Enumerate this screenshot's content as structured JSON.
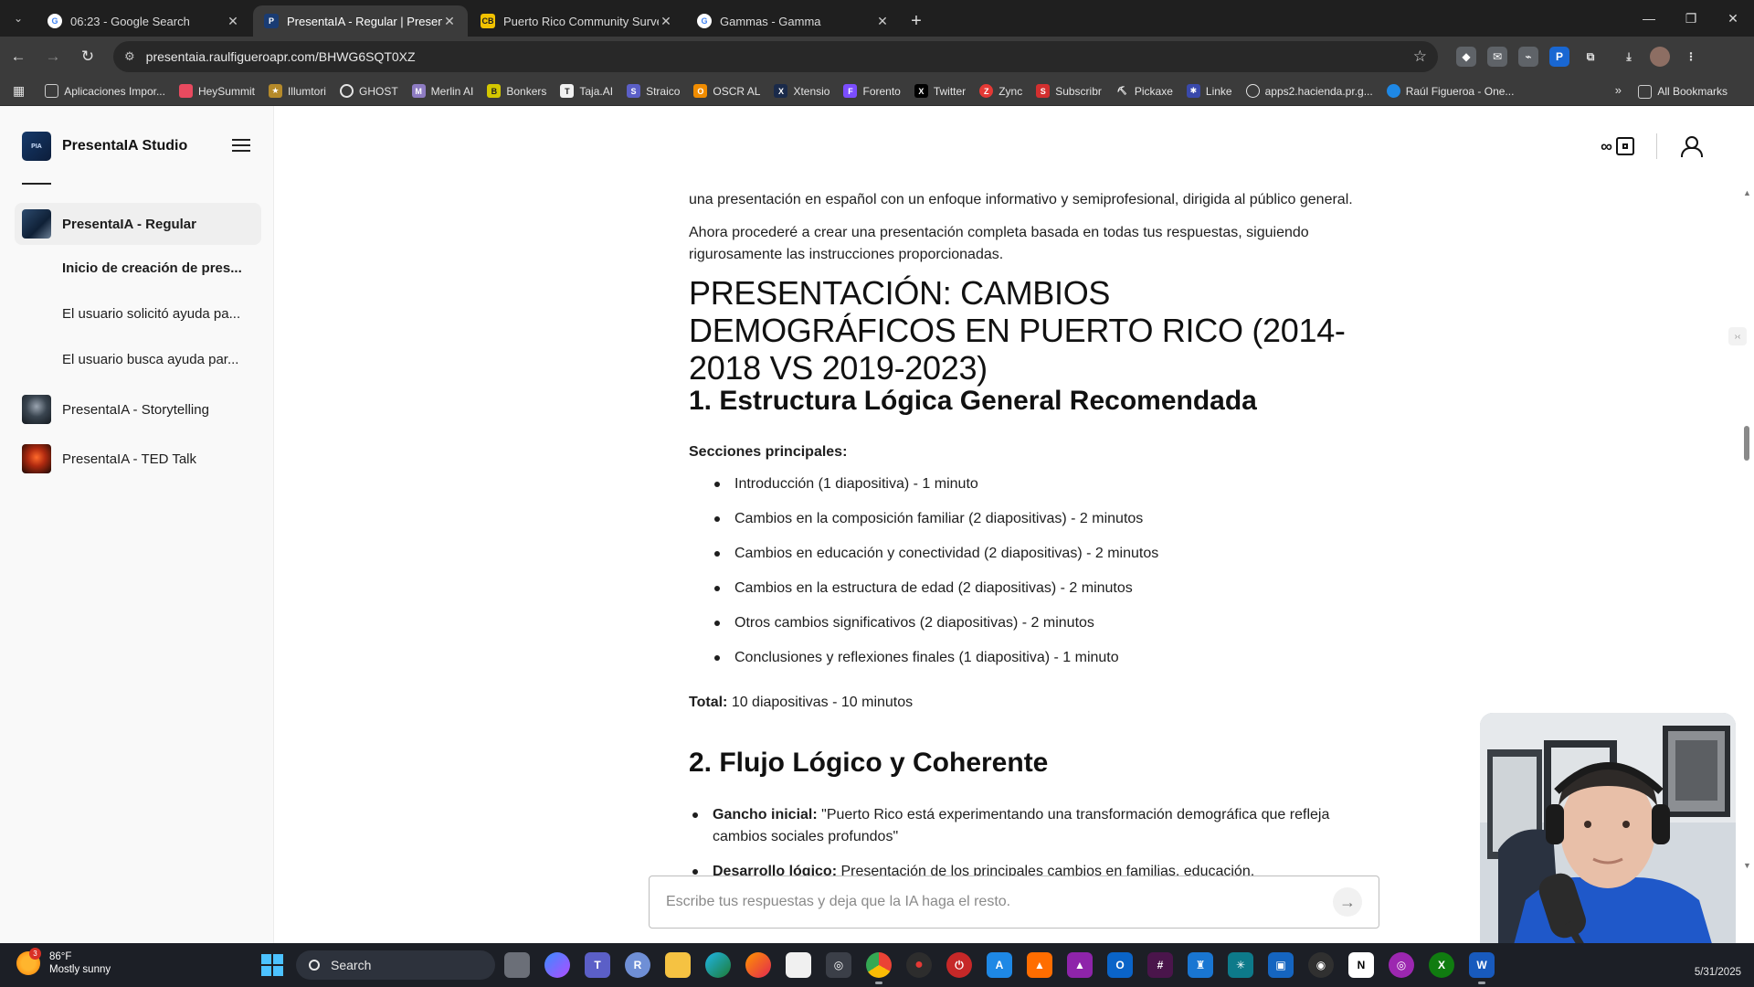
{
  "browser": {
    "tabs": [
      {
        "title": "06:23 - Google Search",
        "favicon": "google-icon",
        "active": false
      },
      {
        "title": "PresentaIA - Regular | Presenta",
        "favicon": "presentaia-icon",
        "active": true
      },
      {
        "title": "Puerto Rico Community Survey",
        "favicon": "cb-icon",
        "active": false
      },
      {
        "title": "Gammas - Gamma",
        "favicon": "google-icon",
        "active": false
      }
    ],
    "url": "presentaia.raulfigueroapr.com/BHWG6SQT0XZ",
    "bookmarks": [
      "Aplicaciones Impor...",
      "HeySummit",
      "Illumtori",
      "GHOST",
      "Merlin AI",
      "Bonkers",
      "Taja.AI",
      "Straico",
      "OSCR AL",
      "Xtensio",
      "Forento",
      "Twitter",
      "Zync",
      "Subscribr",
      "Pickaxe",
      "Linke",
      "apps2.hacienda.pr.g...",
      "Raúl Figueroa - One..."
    ],
    "bookmarks_more": "»",
    "all_bookmarks": "All Bookmarks"
  },
  "sidebar": {
    "brand": "PresentaIA Studio",
    "items": [
      {
        "label": "PresentaIA - Regular",
        "active": true
      },
      {
        "label": "PresentaIA - Storytelling",
        "active": false
      },
      {
        "label": "PresentaIA - TED Talk",
        "active": false
      }
    ],
    "conversations": [
      "Inicio de creación de pres...",
      "El usuario solicitó ayuda pa...",
      "El usuario busca ayuda par..."
    ]
  },
  "content": {
    "intro_1": "una presentación en español con un enfoque informativo y semiprofesional, dirigida al público general.",
    "intro_2": "Ahora procederé a crear una presentación completa basada en todas tus respuestas, siguiendo rigurosamente las instrucciones proporcionadas.",
    "title": "PRESENTACIÓN: CAMBIOS DEMOGRÁFICOS EN PUERTO RICO (2014-2018 VS 2019-2023)",
    "section1_heading": "1. Estructura Lógica General Recomendada",
    "sections_label": "Secciones principales:",
    "sections": [
      "Introducción (1 diapositiva) - 1 minuto",
      "Cambios en la composición familiar (2 diapositivas) - 2 minutos",
      "Cambios en educación y conectividad (2 diapositivas) - 2 minutos",
      "Cambios en la estructura de edad (2 diapositivas) - 2 minutos",
      "Otros cambios significativos (2 diapositivas) - 2 minutos",
      "Conclusiones y reflexiones finales (1 diapositiva) - 1 minuto"
    ],
    "total_label": "Total:",
    "total_value": "10 diapositivas - 10 minutos",
    "section2_heading": "2. Flujo Lógico y Coherente",
    "flow": [
      {
        "label": "Gancho inicial:",
        "text": "\"Puerto Rico está experimentando una transformación demográfica que refleja cambios sociales profundos\""
      },
      {
        "label": "Desarrollo lógico:",
        "text": "Presentación de los principales cambios en familias, educación,"
      }
    ]
  },
  "chat": {
    "placeholder": "Escribe tus respuestas y deja que la IA haga el resto."
  },
  "taskbar": {
    "temperature": "86°F",
    "condition": "Mostly sunny",
    "weather_badge": "3",
    "search_label": "Search",
    "date": "5/31/2025"
  }
}
